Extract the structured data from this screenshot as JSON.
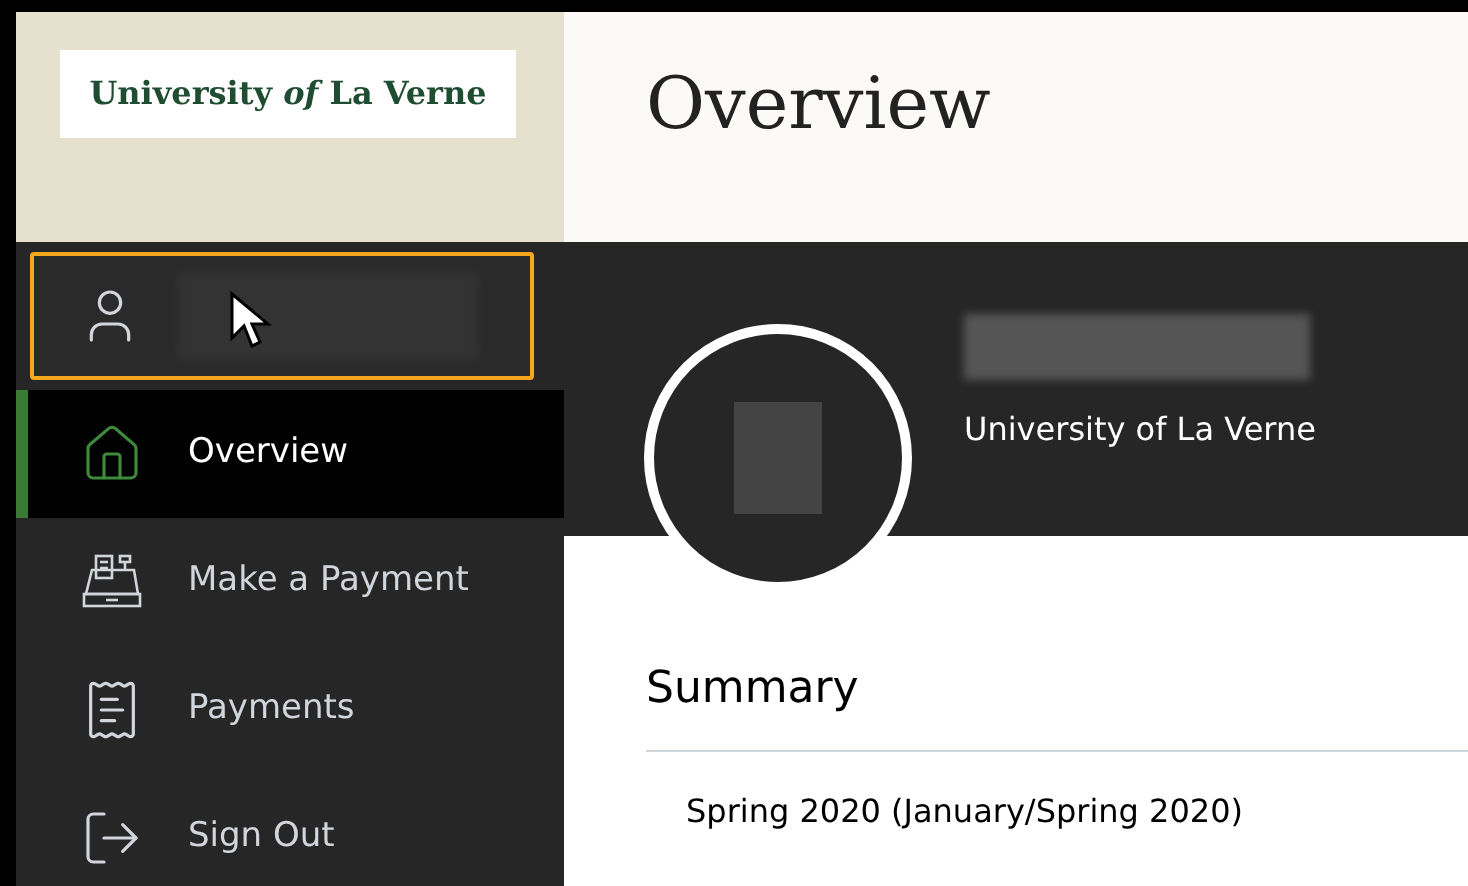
{
  "logo": {
    "text": "University *of* La Verne"
  },
  "user": {
    "focused": true
  },
  "nav": [
    {
      "kind": "home",
      "label": "Overview",
      "selected": true
    },
    {
      "kind": "register",
      "label": "Make a Payment",
      "selected": false
    },
    {
      "kind": "receipt",
      "label": "Payments",
      "selected": false
    },
    {
      "kind": "signout",
      "label": "Sign Out",
      "selected": false
    }
  ],
  "page": {
    "title": "Overview"
  },
  "profile": {
    "institution": "University of La Verne"
  },
  "summary": {
    "heading": "Summary",
    "items": [
      "Spring 2020 (January/Spring 2020)"
    ]
  }
}
